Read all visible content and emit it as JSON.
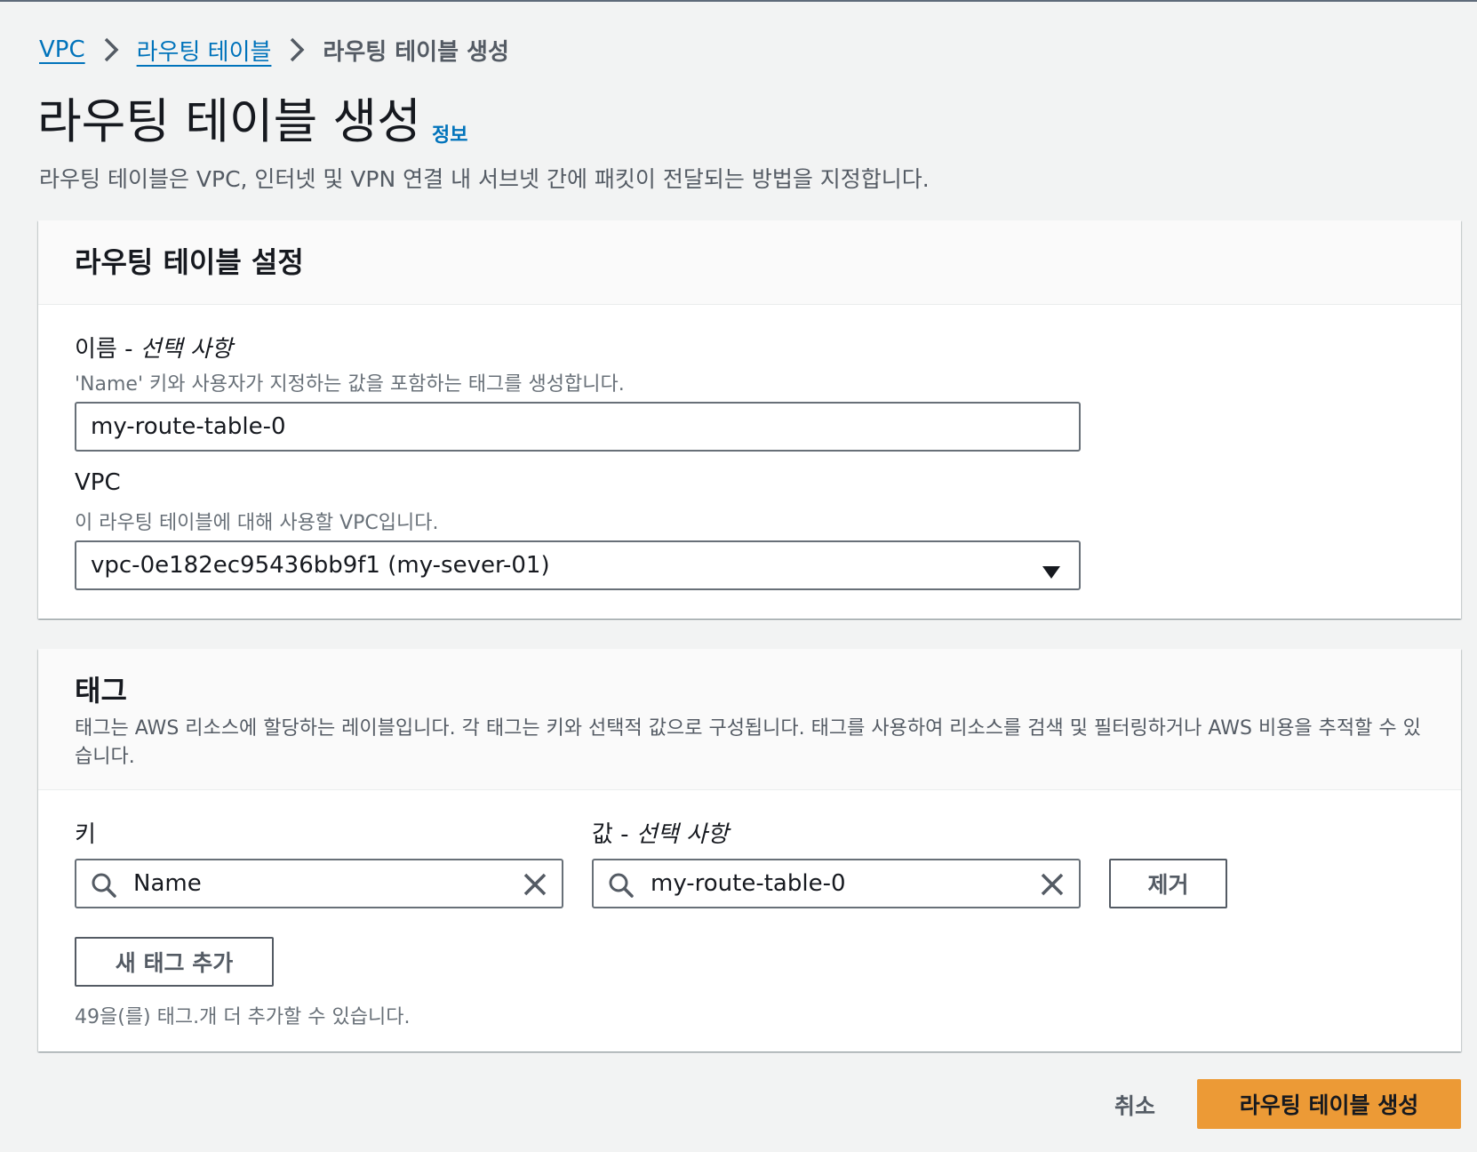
{
  "breadcrumb": {
    "items": [
      {
        "label": "VPC"
      },
      {
        "label": "라우팅 테이블"
      },
      {
        "label": "라우팅 테이블 생성"
      }
    ]
  },
  "header": {
    "title": "라우팅 테이블 생성",
    "info_link": "정보",
    "description": "라우팅 테이블은 VPC, 인터넷 및 VPN 연결 내 서브넷 간에 패킷이 전달되는 방법을 지정합니다."
  },
  "settings_panel": {
    "title": "라우팅 테이블 설정",
    "name_field": {
      "label": "이름 - ",
      "label_optional": "선택 사항",
      "hint": "'Name' 키와 사용자가 지정하는 값을 포함하는 태그를 생성합니다.",
      "value": "my-route-table-0"
    },
    "vpc_field": {
      "label": "VPC",
      "hint": "이 라우팅 테이블에 대해 사용할 VPC입니다.",
      "selected": "vpc-0e182ec95436bb9f1 (my-sever-01)"
    }
  },
  "tags_panel": {
    "title": "태그",
    "description": "태그는 AWS 리소스에 할당하는 레이블입니다. 각 태그는 키와 선택적 값으로 구성됩니다. 태그를 사용하여 리소스를 검색 및 필터링하거나 AWS 비용을 추적할 수 있습니다.",
    "key_label": "키",
    "value_label": "값 - ",
    "value_label_optional": "선택 사항",
    "tags": [
      {
        "key": "Name",
        "value": "my-route-table-0"
      }
    ],
    "remove_button": "제거",
    "add_button": "새 태그 추가",
    "remaining_hint": "49을(를) 태그.개 더 추가할 수 있습니다."
  },
  "footer": {
    "cancel_label": "취소",
    "submit_label": "라우팅 테이블 생성"
  },
  "colors": {
    "link": "#0073bb",
    "primary_button": "#ec9a36",
    "background": "#f2f3f3"
  },
  "icons": [
    "chevron-right-icon",
    "caret-down-icon",
    "search-icon",
    "close-icon"
  ]
}
